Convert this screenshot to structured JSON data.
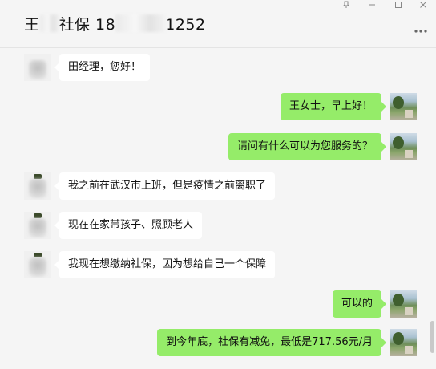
{
  "window": {
    "min_icon": "minimize-icon",
    "max_icon": "maximize-icon",
    "close_icon": "close-icon",
    "pin_icon": "pin-icon",
    "more_icon": "more-icon"
  },
  "header": {
    "title_prefix": "王",
    "title_mid": "社保 18",
    "title_suffix": "1252"
  },
  "messages": [
    {
      "side": "in",
      "text": "田经理，您好！"
    },
    {
      "side": "out",
      "text": "王女士，早上好！"
    },
    {
      "side": "out",
      "text": "请问有什么可以为您服务的？"
    },
    {
      "side": "in",
      "text": "我之前在武汉市上班，但是疫情之前离职了"
    },
    {
      "side": "in",
      "text": "现在在家带孩子、照顾老人"
    },
    {
      "side": "in",
      "text": "我现在想缴纳社保，因为想给自己一个保障"
    },
    {
      "side": "out",
      "text": "可以的"
    },
    {
      "side": "out",
      "text": "到今年底，社保有减免，最低是717.56元/月"
    }
  ],
  "colors": {
    "outgoing_bubble": "#95ec69",
    "incoming_bubble": "#ffffff",
    "background": "#f5f5f5"
  }
}
